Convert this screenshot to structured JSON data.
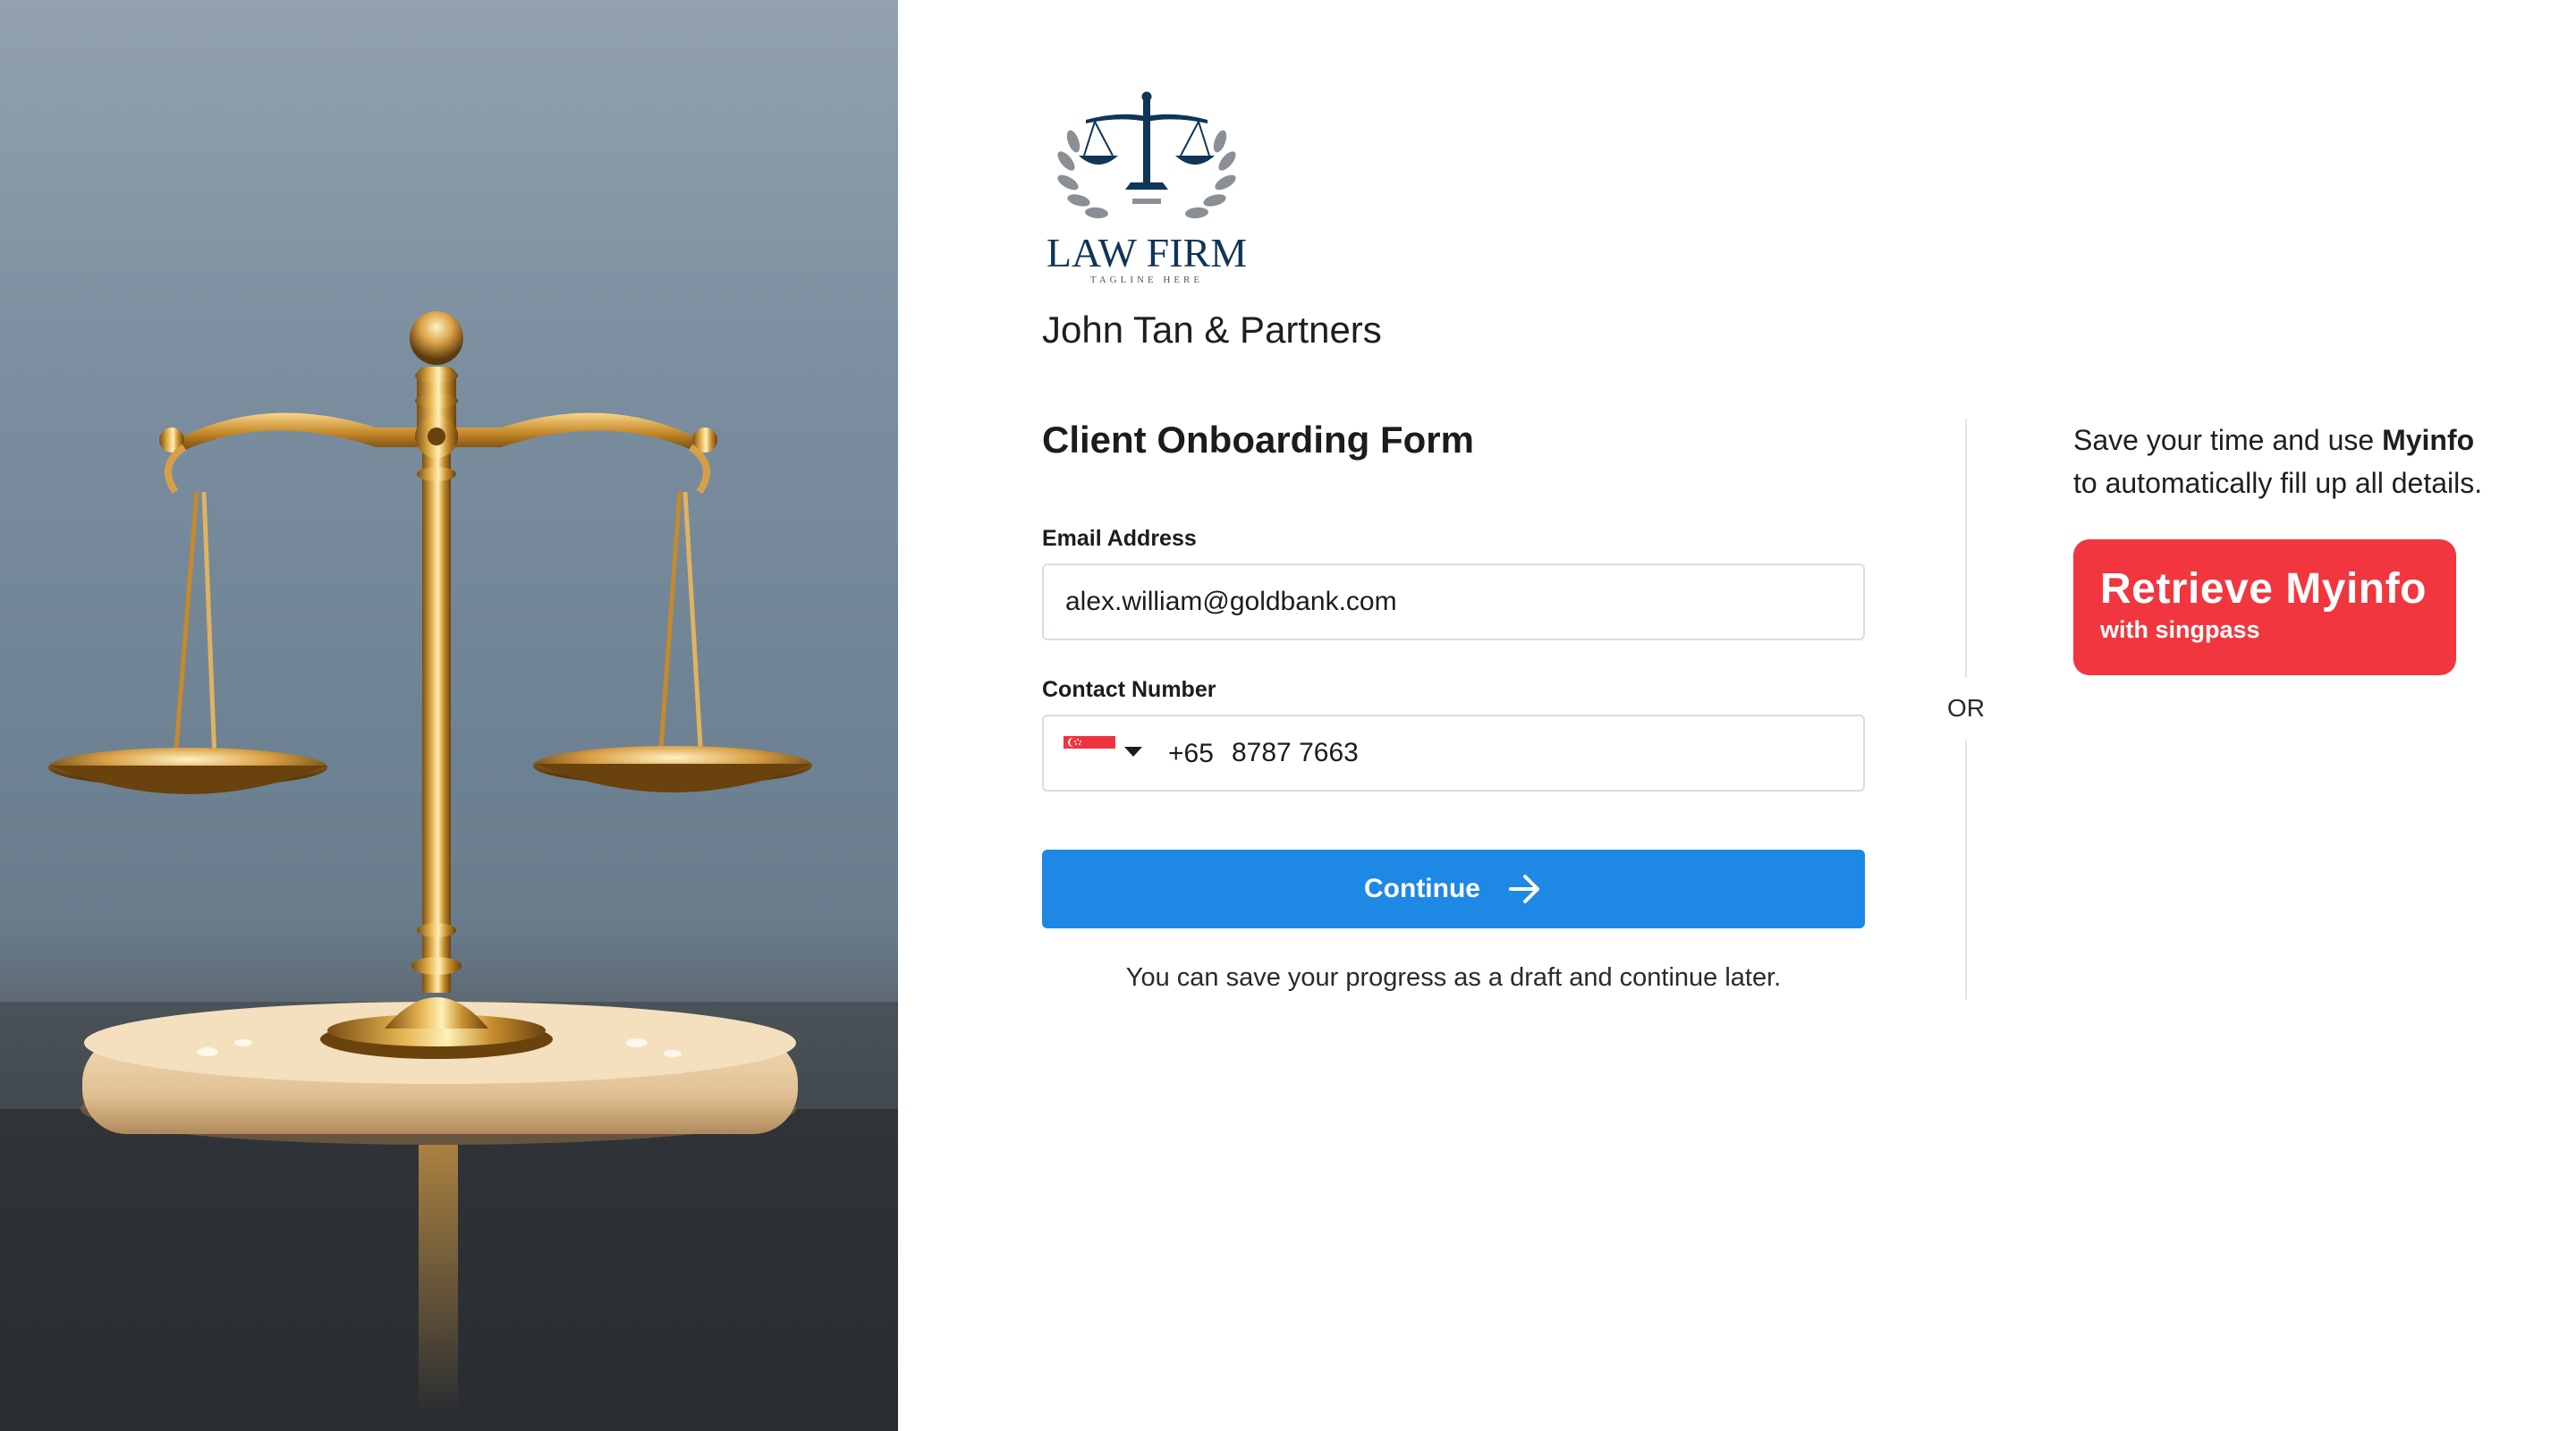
{
  "logo": {
    "title": "LAW FIRM",
    "tagline": "TAGLINE HERE"
  },
  "firm_name": "John Tan & Partners",
  "form": {
    "title": "Client Onboarding Form",
    "email": {
      "label": "Email Address",
      "value": "alex.william@goldbank.com"
    },
    "phone": {
      "label": "Contact Number",
      "country": "singapore-flag-icon",
      "dial_code": "+65",
      "value": "8787 7663"
    },
    "continue_label": "Continue",
    "hint": "You can save your progress as a draft and continue later."
  },
  "divider": {
    "or_label": "OR"
  },
  "myinfo": {
    "text_before": "Save your time and use ",
    "text_bold": "Myinfo",
    "text_after": "to automatically fill up all details.",
    "button_title": "Retrieve Myinfo",
    "button_sub": "with singpass"
  },
  "colors": {
    "primary": "#1e88e5",
    "myinfo_red": "#f2363f",
    "logo_navy": "#0f3557",
    "border": "#d9dde2"
  }
}
